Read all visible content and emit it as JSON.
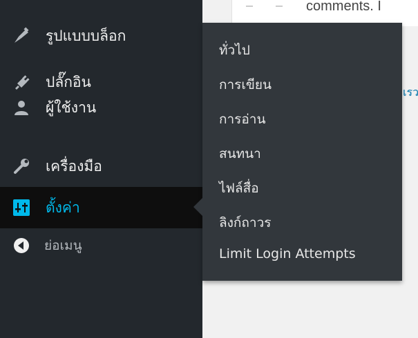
{
  "page_content": {
    "comments_text": "comments. I",
    "peek_link": "เรว"
  },
  "sidebar": {
    "items": [
      {
        "label": "รูปแบบบล็อก",
        "icon": "appearance-brush-icon"
      },
      {
        "label": "ปลั๊กอิน",
        "icon": "plugin-plug-icon"
      },
      {
        "label": "ผู้ใช้งาน",
        "icon": "users-person-icon"
      },
      {
        "label": "เครื่องมือ",
        "icon": "tools-wrench-icon"
      },
      {
        "label": "ตั้งค่า",
        "icon": "settings-sliders-icon",
        "active": true
      },
      {
        "label": "ย่อเมนู",
        "icon": "collapse-arrow-icon"
      }
    ]
  },
  "submenu": {
    "items": [
      {
        "label": "ทั่วไป"
      },
      {
        "label": "การเขียน"
      },
      {
        "label": "การอ่าน"
      },
      {
        "label": "สนทนา"
      },
      {
        "label": "ไฟล์สื่อ"
      },
      {
        "label": "ลิงก์ถาวร"
      },
      {
        "label": "Limit Login Attempts"
      }
    ]
  },
  "colors": {
    "sidebar_bg": "#23282d",
    "flyout_bg": "#32373c",
    "active_bg": "#0e0e0e",
    "active_text": "#00b9eb",
    "link": "#0073aa"
  }
}
